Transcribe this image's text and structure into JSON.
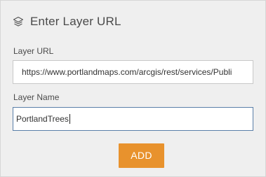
{
  "header": {
    "icon": "layers-icon",
    "title": "Enter Layer URL"
  },
  "form": {
    "url_label": "Layer URL",
    "url_value": "https://www.portlandmaps.com/arcgis/rest/services/Publi",
    "name_label": "Layer Name",
    "name_value": "PortlandTrees"
  },
  "actions": {
    "add_label": "ADD"
  },
  "colors": {
    "accent": "#e8922d",
    "panel_bg": "#efefef",
    "focus_border": "#5a7fa8"
  }
}
